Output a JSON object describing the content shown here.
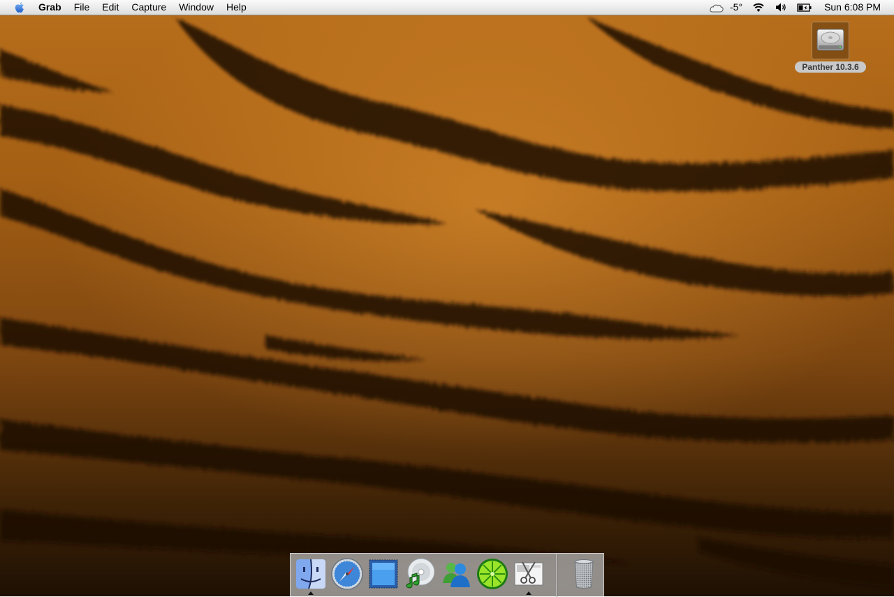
{
  "menubar": {
    "app_name": "Grab",
    "items": [
      "File",
      "Edit",
      "Capture",
      "Window",
      "Help"
    ],
    "status": {
      "weather_icon": "cloud-icon",
      "temperature": "-5°",
      "wifi_icon": "wifi-icon",
      "volume_icon": "volume-icon",
      "battery_icon": "battery-icon",
      "clock": "Sun 6:08 PM"
    }
  },
  "desktop": {
    "wallpaper": "tiger-fur",
    "icons": [
      {
        "label": "Panther 10.3.6",
        "icon": "hard-drive-icon"
      }
    ]
  },
  "dock": {
    "apps": [
      {
        "name": "Finder",
        "icon": "finder-icon",
        "running": true
      },
      {
        "name": "Safari",
        "icon": "safari-icon",
        "running": false
      },
      {
        "name": "Preview",
        "icon": "preview-icon",
        "running": false
      },
      {
        "name": "iTunes",
        "icon": "itunes-icon",
        "running": false
      },
      {
        "name": "MSN Messenger",
        "icon": "messenger-icon",
        "running": false
      },
      {
        "name": "LimeWire",
        "icon": "limewire-icon",
        "running": false
      },
      {
        "name": "Grab",
        "icon": "grab-icon",
        "running": true
      }
    ],
    "trash": {
      "name": "Trash",
      "icon": "trash-icon"
    }
  },
  "colors": {
    "menubar": "#ececec",
    "wallpaper_base": "#a45f14",
    "stripe": "#1c0f04",
    "apple_blue": "#2f6fd8"
  }
}
